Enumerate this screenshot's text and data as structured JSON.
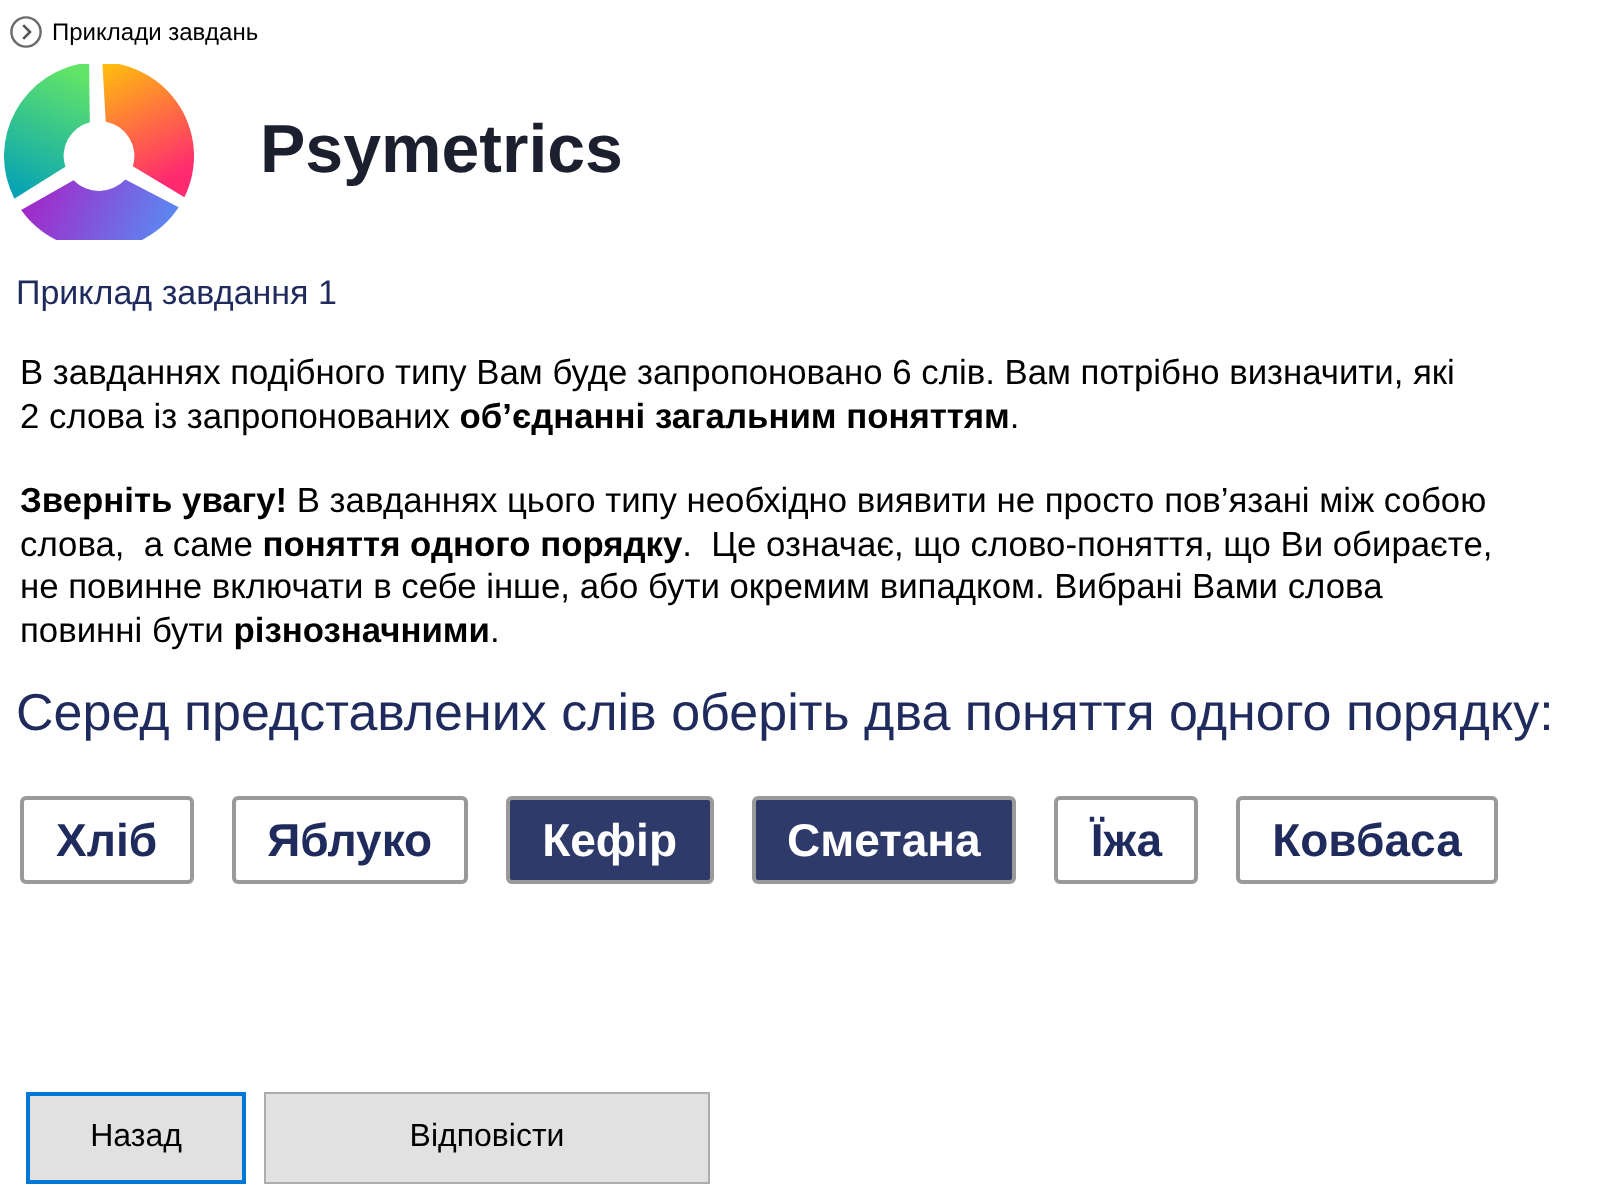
{
  "header": {
    "back_link": "Приклади завдань"
  },
  "logo": {
    "text": "Psymetrics"
  },
  "task": {
    "title": "Приклад завдання 1",
    "paragraphs": [
      "В завданнях подібного типу Вам буде запропоновано 6 слів. Вам потрібно визначити, які 2 слова із запропонованих **об’єднанні загальним поняттям**.",
      "**Зверніть увагу!** В завданнях цього типу необхідно виявити не просто пов’язані між собою слова,  а саме **поняття одного порядку**.  Це означає, що слово-поняття, що Ви обираєте, не повинне включати в себе інше, або бути окремим випадком. Вибрані Вами слова повинні бути **різнозначними**."
    ],
    "question": "Серед представлених слів оберіть два поняття одного порядку:",
    "words": [
      {
        "label": "Хліб",
        "selected": false
      },
      {
        "label": "Яблуко",
        "selected": false
      },
      {
        "label": "Кефір",
        "selected": true
      },
      {
        "label": "Сметана",
        "selected": true
      },
      {
        "label": "Їжа",
        "selected": false
      },
      {
        "label": "Ковбаса",
        "selected": false
      }
    ]
  },
  "buttons": [
    {
      "label": "Назад",
      "focused": true
    },
    {
      "label": "Відповісти",
      "focused": false
    }
  ]
}
